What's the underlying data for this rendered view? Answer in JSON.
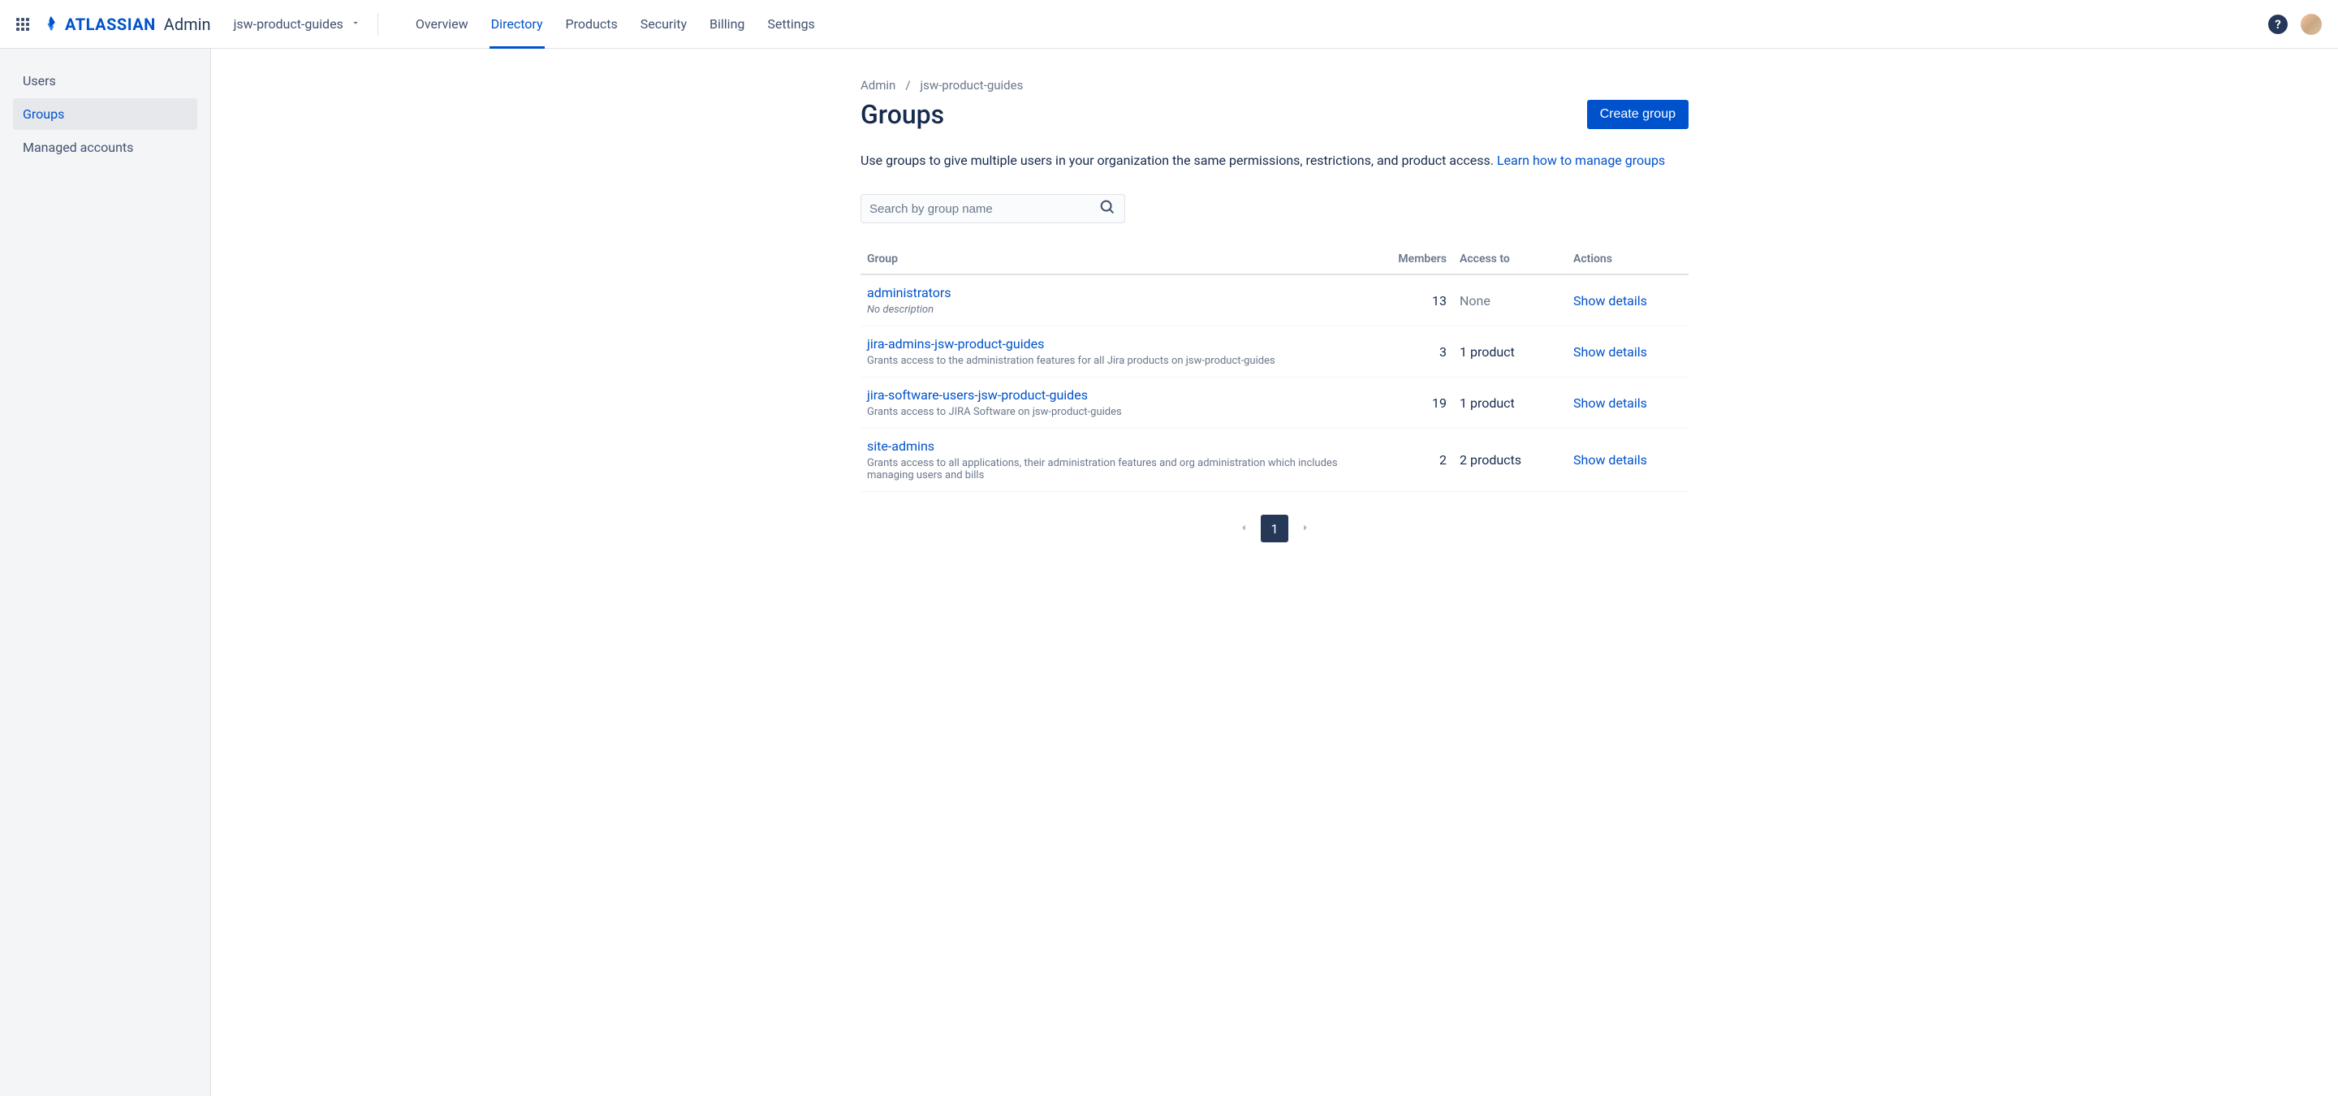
{
  "header": {
    "logo_text": "ATLASSIAN",
    "logo_suffix": "Admin",
    "site_name": "jsw-product-guides",
    "nav": [
      "Overview",
      "Directory",
      "Products",
      "Security",
      "Billing",
      "Settings"
    ],
    "nav_active": 1
  },
  "sidebar": {
    "items": [
      "Users",
      "Groups",
      "Managed accounts"
    ],
    "active": 1
  },
  "breadcrumb": {
    "items": [
      "Admin",
      "jsw-product-guides"
    ]
  },
  "page": {
    "title": "Groups",
    "create_label": "Create group",
    "description": "Use groups to give multiple users in your organization the same permissions, restrictions, and product access. ",
    "learn_link": "Learn how to manage groups"
  },
  "search": {
    "placeholder": "Search by group name"
  },
  "table": {
    "headers": {
      "group": "Group",
      "members": "Members",
      "access": "Access to",
      "actions": "Actions"
    },
    "show_details": "Show details",
    "rows": [
      {
        "name": "administrators",
        "desc": "No description",
        "desc_italic": true,
        "members": "13",
        "access": "None",
        "access_none": true
      },
      {
        "name": "jira-admins-jsw-product-guides",
        "desc": "Grants access to the administration features for all Jira products on jsw-product-guides",
        "members": "3",
        "access": "1 product"
      },
      {
        "name": "jira-software-users-jsw-product-guides",
        "desc": "Grants access to JIRA Software on jsw-product-guides",
        "members": "19",
        "access": "1 product"
      },
      {
        "name": "site-admins",
        "desc": "Grants access to all applications, their administration features and org administration which includes managing users and bills",
        "members": "2",
        "access": "2 products"
      }
    ]
  },
  "pagination": {
    "current": "1"
  }
}
